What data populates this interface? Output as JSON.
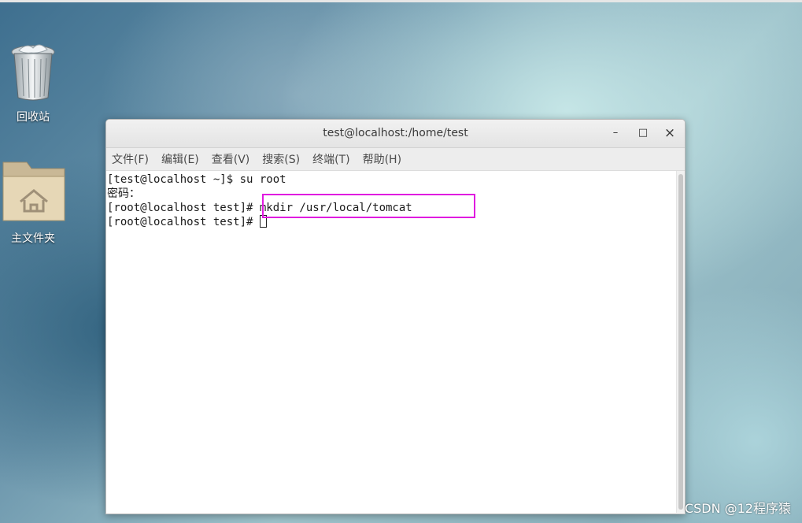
{
  "desktop": {
    "icons": [
      {
        "label": "回收站",
        "icon": "trash-icon"
      },
      {
        "label": "主文件夹",
        "icon": "home-folder-icon"
      }
    ]
  },
  "window": {
    "title": "test@localhost:/home/test",
    "controls": {
      "minimize": "–",
      "maximize": "□",
      "close": "×"
    },
    "menu": [
      "文件(F)",
      "编辑(E)",
      "查看(V)",
      "搜索(S)",
      "终端(T)",
      "帮助(H)"
    ]
  },
  "terminal": {
    "lines": [
      "[test@localhost ~]$ su root",
      "密码：",
      "[root@localhost test]# mkdir /usr/local/tomcat",
      "[root@localhost test]# "
    ],
    "highlight_color": "#e01be0"
  },
  "watermark": "CSDN @12程序猿"
}
